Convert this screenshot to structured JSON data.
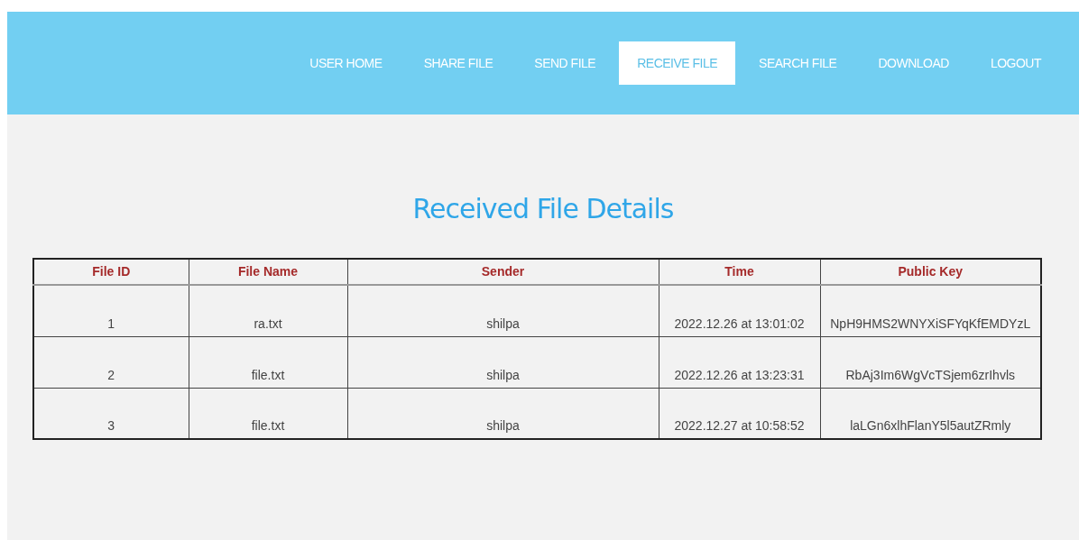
{
  "nav": [
    {
      "label": "USER HOME",
      "selected": false
    },
    {
      "label": "SHARE FILE",
      "selected": false
    },
    {
      "label": "SEND FILE",
      "selected": false
    },
    {
      "label": "RECEIVE FILE",
      "selected": true
    },
    {
      "label": "SEARCH FILE",
      "selected": false
    },
    {
      "label": "DOWNLOAD",
      "selected": false
    },
    {
      "label": "LOGOUT",
      "selected": false
    }
  ],
  "title": "Received File Details",
  "table": {
    "columns": [
      "File ID",
      "File Name",
      "Sender",
      "Time",
      "Public Key"
    ],
    "rows": [
      [
        "1",
        "ra.txt",
        "shilpa",
        "2022.12.26 at 13:01:02",
        "NpH9HMS2WNYXiSFYqKfEMDYzL"
      ],
      [
        "2",
        "file.txt",
        "shilpa",
        "2022.12.26 at 13:23:31",
        "RbAj3Im6WgVcTSjem6zrIhvls"
      ],
      [
        "3",
        "file.txt",
        "shilpa",
        "2022.12.27 at 10:58:52",
        "laLGn6xlhFlanY5l5autZRmly"
      ]
    ]
  }
}
